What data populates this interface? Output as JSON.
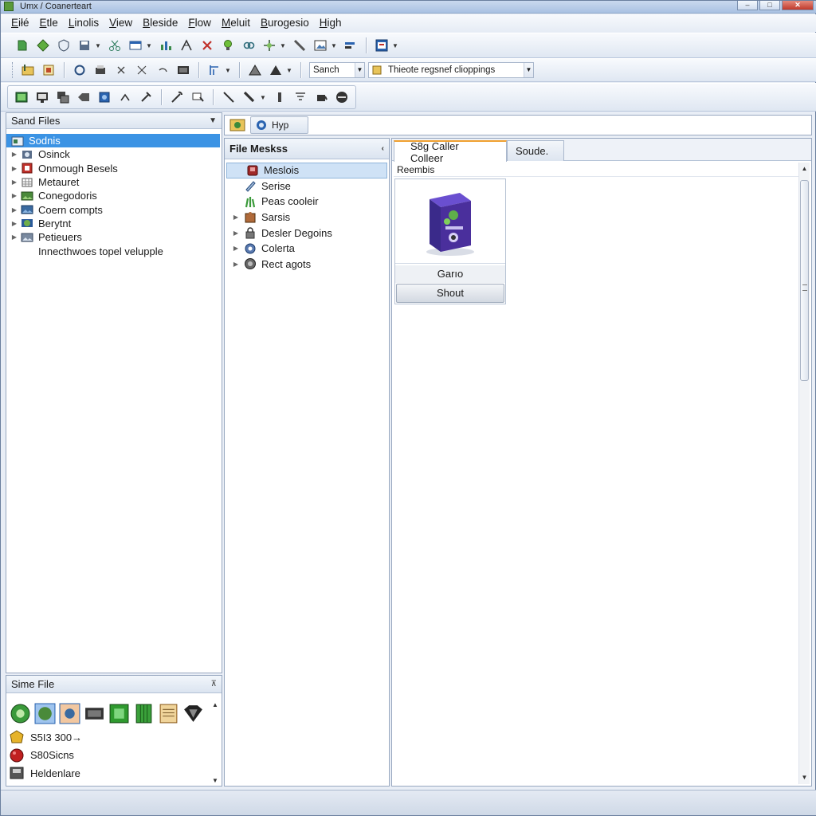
{
  "window": {
    "title": "Umx / Coanerteart",
    "controls": [
      "–",
      "□",
      "✕"
    ]
  },
  "menu": [
    "Eiłé",
    "Etle",
    "Linolis",
    "View",
    "Bleside",
    "Flow",
    "Meluit",
    "Burogesio",
    "High"
  ],
  "toolbar3": {
    "search_combo": "Sanch",
    "filter_combo": "Thieote regsnef clioppings"
  },
  "left_panel": {
    "title": "Sand Files",
    "items": [
      {
        "label": "Sodnis",
        "selected": true,
        "icon": "folder-icon"
      },
      {
        "label": "Osinck",
        "selected": false,
        "icon": "gear-icon"
      },
      {
        "label": "Onmough Besels",
        "selected": false,
        "icon": "red-box-icon"
      },
      {
        "label": "Metauret",
        "selected": false,
        "icon": "grid-icon"
      },
      {
        "label": "Conegodoris",
        "selected": false,
        "icon": "picture-icon"
      },
      {
        "label": "Coern compts",
        "selected": false,
        "icon": "picture-icon"
      },
      {
        "label": "Berytnt",
        "selected": false,
        "icon": "globe-icon"
      },
      {
        "label": "Petieuers",
        "selected": false,
        "icon": "picture-icon"
      }
    ],
    "footer_text": "Innecthwoes topel velupple"
  },
  "bottom_left_panel": {
    "title": "Sime File",
    "strip_icons": [
      "green-circle-icon",
      "globe-icon",
      "sound-icon",
      "chip-icon",
      "green-box-icon",
      "green-crate-icon",
      "notepad-icon",
      "diamond-icon"
    ],
    "items": [
      {
        "label": "S5I3 300→",
        "icon": "gold-icon"
      },
      {
        "label": "S80Sicns",
        "icon": "red-ball-icon"
      },
      {
        "label": "Heldenlare",
        "icon": "disk-icon"
      }
    ]
  },
  "path_bar": {
    "tab_label": "Hyp"
  },
  "middle_panel": {
    "title": "File Meskss",
    "items": [
      {
        "label": "Meslois",
        "selected": true,
        "has_children": false,
        "icon": "red-cube-icon"
      },
      {
        "label": "Serise",
        "selected": false,
        "has_children": false,
        "icon": "pen-icon"
      },
      {
        "label": "Peas cooleir",
        "selected": false,
        "has_children": false,
        "icon": "grass-icon"
      },
      {
        "label": "Sarsis",
        "selected": false,
        "has_children": true,
        "icon": "puzzle-icon"
      },
      {
        "label": "Desler Degoins",
        "selected": false,
        "has_children": true,
        "icon": "lock-icon"
      },
      {
        "label": "Colerta",
        "selected": false,
        "has_children": true,
        "icon": "gear-icon"
      },
      {
        "label": "Rect agots",
        "selected": false,
        "has_children": true,
        "icon": "target-icon"
      }
    ]
  },
  "right_panel": {
    "tabs": [
      {
        "label": "S8g Caller Colleer",
        "active": true
      },
      {
        "label": "Soude.",
        "active": false
      }
    ],
    "content_header": "Reembis",
    "item": {
      "name": "Garıo",
      "button": "Shout",
      "image": "purple-box-icon"
    }
  },
  "colors": {
    "selection": "#3b93e4",
    "tab_accent": "#f0a030",
    "product_box": "#4a2f9c"
  }
}
